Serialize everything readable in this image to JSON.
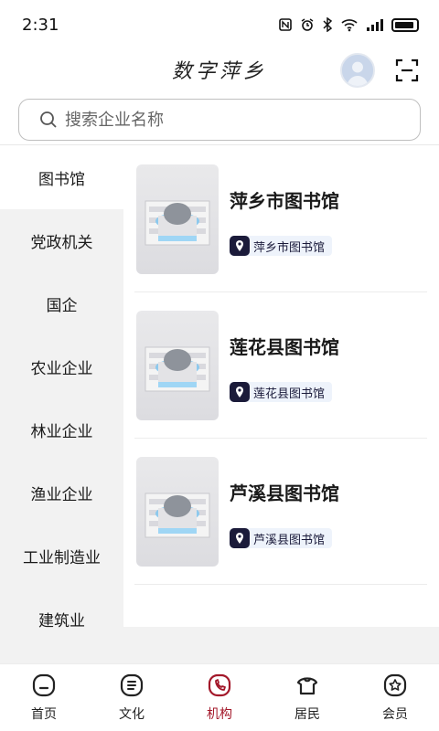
{
  "status_bar": {
    "time": "2:31",
    "icons": [
      "nfc-icon",
      "alarm-icon",
      "bluetooth-icon",
      "wifi-icon",
      "signal-icon",
      "battery-icon"
    ]
  },
  "header": {
    "title": "数字萍乡",
    "avatar_icon": "user-avatar",
    "scan_icon": "scan-icon"
  },
  "search": {
    "placeholder": "搜索企业名称"
  },
  "sidebar": {
    "items": [
      {
        "label": "图书馆",
        "active": true
      },
      {
        "label": "党政机关",
        "active": false
      },
      {
        "label": "国企",
        "active": false
      },
      {
        "label": "农业企业",
        "active": false
      },
      {
        "label": "林业企业",
        "active": false
      },
      {
        "label": "渔业企业",
        "active": false
      },
      {
        "label": "工业制造业",
        "active": false
      },
      {
        "label": "建筑业",
        "active": false
      }
    ]
  },
  "cards": [
    {
      "title": "萍乡市图书馆",
      "tag": "萍乡市图书馆"
    },
    {
      "title": "莲花县图书馆",
      "tag": "莲花县图书馆"
    },
    {
      "title": "芦溪县图书馆",
      "tag": "芦溪县图书馆"
    }
  ],
  "tab_bar": {
    "tabs": [
      {
        "label": "首页",
        "icon": "home-icon",
        "active": false
      },
      {
        "label": "文化",
        "icon": "culture-icon",
        "active": false
      },
      {
        "label": "机构",
        "icon": "institution-icon",
        "active": true
      },
      {
        "label": "居民",
        "icon": "resident-icon",
        "active": false
      },
      {
        "label": "会员",
        "icon": "member-icon",
        "active": false
      }
    ]
  },
  "colors": {
    "accent": "#a3182a",
    "sidebar_bg": "#f2f2f2",
    "tag_bg": "#eef3fb",
    "pin_bg": "#1b1b3a"
  }
}
